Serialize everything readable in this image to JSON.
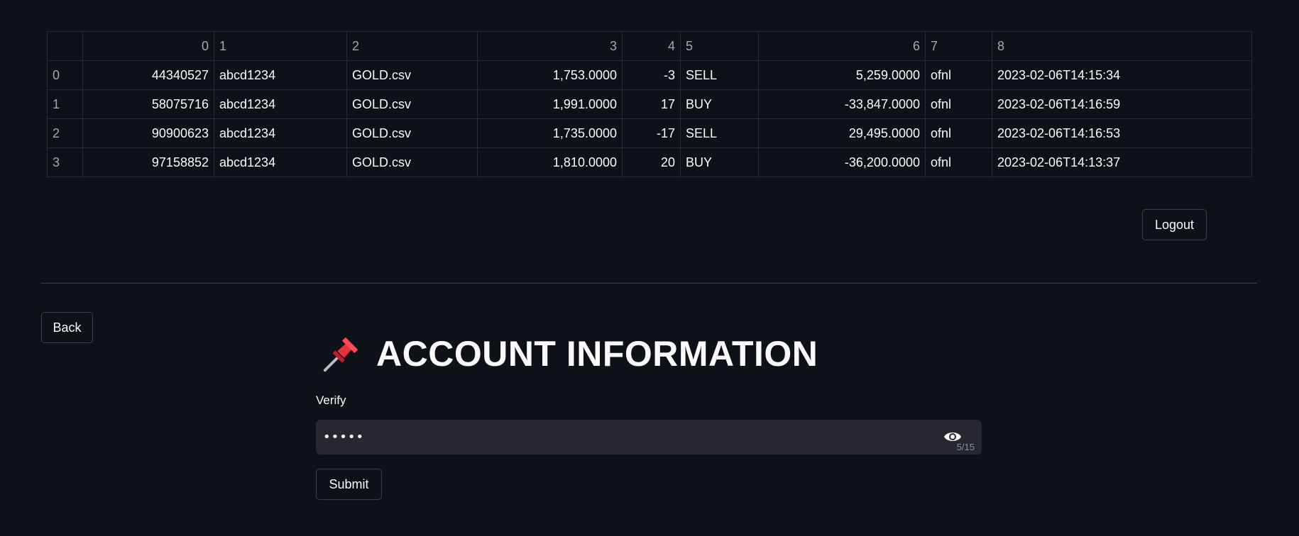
{
  "table": {
    "columns": [
      "",
      "0",
      "1",
      "2",
      "3",
      "4",
      "5",
      "6",
      "7",
      "8"
    ],
    "rows": [
      [
        "0",
        "44340527",
        "abcd1234",
        "GOLD.csv",
        "1,753.0000",
        "-3",
        "SELL",
        "5,259.0000",
        "ofnl",
        "2023-02-06T14:15:34"
      ],
      [
        "1",
        "58075716",
        "abcd1234",
        "GOLD.csv",
        "1,991.0000",
        "17",
        "BUY",
        "-33,847.0000",
        "ofnl",
        "2023-02-06T14:16:59"
      ],
      [
        "2",
        "90900623",
        "abcd1234",
        "GOLD.csv",
        "1,735.0000",
        "-17",
        "SELL",
        "29,495.0000",
        "ofnl",
        "2023-02-06T14:16:53"
      ],
      [
        "3",
        "97158852",
        "abcd1234",
        "GOLD.csv",
        "1,810.0000",
        "20",
        "BUY",
        "-36,200.0000",
        "ofnl",
        "2023-02-06T14:13:37"
      ]
    ]
  },
  "buttons": {
    "logout": "Logout",
    "back": "Back",
    "submit": "Submit"
  },
  "heading": {
    "icon": "pushpin-icon",
    "title": "ACCOUNT INFORMATION"
  },
  "form": {
    "verify_label": "Verify",
    "verify_value": "•••••",
    "char_count": "5/15",
    "reveal_icon": "eye-icon"
  },
  "colors": {
    "background": "#0e1117",
    "input_background": "#262730",
    "border": "#3b3f4a",
    "muted_text": "#a3a8b4",
    "pin_red": "#e8303a"
  }
}
